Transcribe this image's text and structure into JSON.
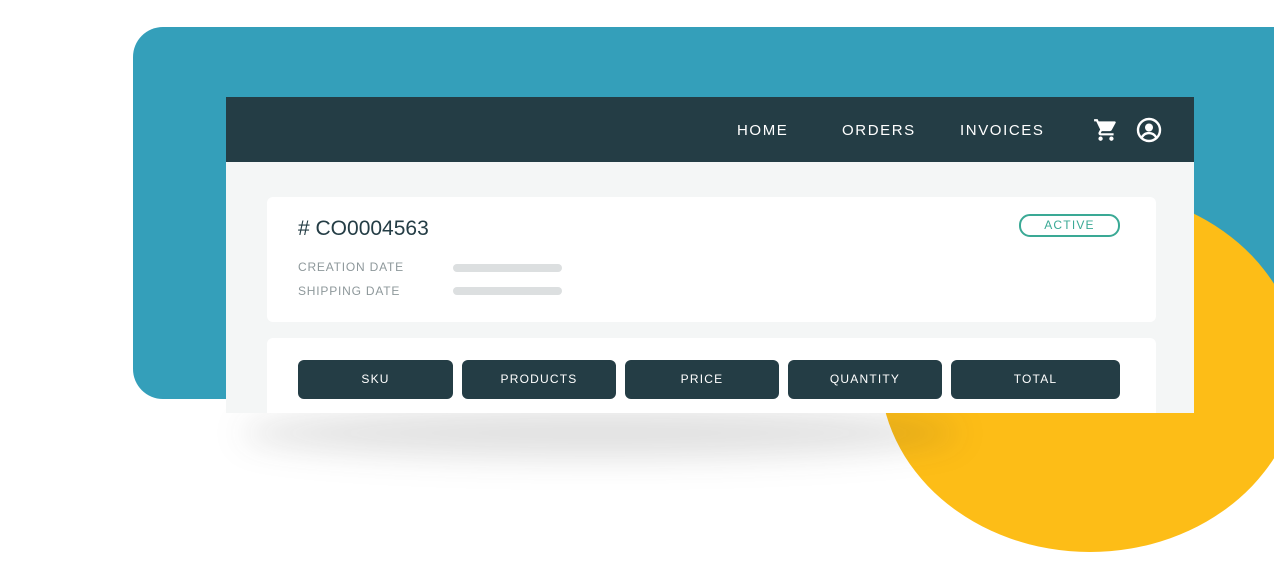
{
  "colors": {
    "background_accent": "#349fba",
    "highlight_circle": "#fdbd17",
    "navbar": "#243d45",
    "status_active": "#3aa995"
  },
  "navbar": {
    "links": [
      "HOME",
      "ORDERS",
      "INVOICES"
    ],
    "icons": [
      "cart-icon",
      "account-icon"
    ]
  },
  "order": {
    "title": "# CO0004563",
    "status": "ACTIVE",
    "fields": [
      {
        "label": "CREATION DATE"
      },
      {
        "label": "SHIPPING DATE"
      }
    ]
  },
  "table": {
    "columns": [
      "SKU",
      "PRODUCTS",
      "PRICE",
      "QUANTITY",
      "TOTAL"
    ]
  }
}
